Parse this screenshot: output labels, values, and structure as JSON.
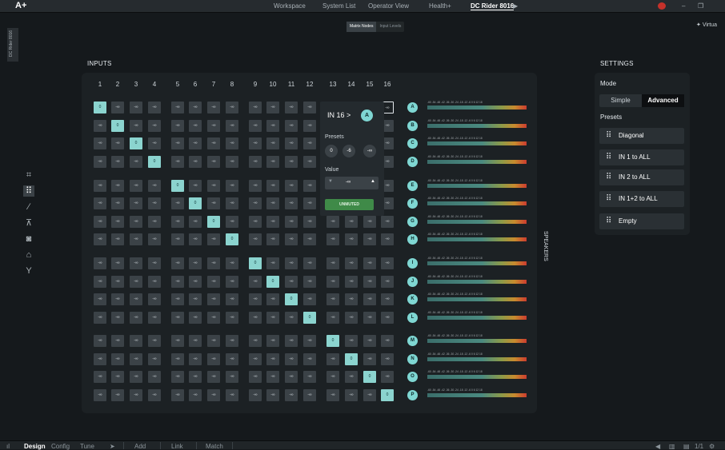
{
  "app": {
    "logo": "A+"
  },
  "top_nav": [
    "Workspace",
    "System List",
    "Operator View",
    "Health+",
    "DC Rider 8016"
  ],
  "sub_tabs": {
    "active": "Matrix Nodes",
    "other": "Input Levels"
  },
  "virtual_label": "Virtua",
  "side_device_label": "DC Rider 8016",
  "sections": {
    "inputs": "INPUTS",
    "settings": "SETTINGS",
    "speakers": "SPEAKERS"
  },
  "input_numbers": [
    "1",
    "2",
    "3",
    "4",
    "5",
    "6",
    "7",
    "8",
    "9",
    "10",
    "11",
    "12",
    "13",
    "14",
    "15",
    "16"
  ],
  "outputs": [
    "A",
    "B",
    "C",
    "D",
    "E",
    "F",
    "G",
    "H",
    "I",
    "J",
    "K",
    "L",
    "M",
    "N",
    "O",
    "P"
  ],
  "cell_off": "-∞",
  "cell_on": "0",
  "meter_scale": "-60 -54 -48 -42 -36 -30 -24 -18 -12  -6   0   6  12  18",
  "popup": {
    "input": "IN 16",
    "sep": ">",
    "output": "A",
    "presets_label": "Presets",
    "presets": [
      "0",
      "-6",
      "-∞"
    ],
    "value_label": "Value",
    "value": "-∞",
    "unmuted": "UNMUTED"
  },
  "settings": {
    "mode_label": "Mode",
    "mode_simple": "Simple",
    "mode_advanced": "Advanced",
    "presets_label": "Presets",
    "presets": [
      "Diagonal",
      "IN 1 to ALL",
      "IN 2 to ALL",
      "IN 1+2 to ALL",
      "Empty"
    ]
  },
  "bottom": {
    "design": "Design",
    "config": "Config",
    "tune": "Tune",
    "add": "Add",
    "link": "Link",
    "match": "Match",
    "page": "1/1"
  }
}
